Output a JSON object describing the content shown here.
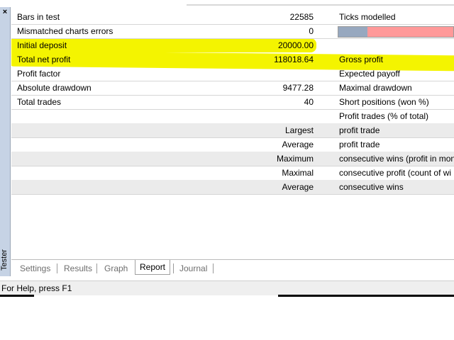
{
  "window": {
    "side_label": "Tester",
    "close_glyph": "×"
  },
  "report": {
    "rows": [
      {
        "label": "Bars in test",
        "value": "22585",
        "right": "Ticks modelled"
      },
      {
        "label": "Mismatched charts errors",
        "value": "0",
        "right": ""
      },
      {
        "label": "Initial deposit",
        "value": "20000.00",
        "right": ""
      },
      {
        "label": "Total net profit",
        "value": "118018.64",
        "right": "Gross profit"
      },
      {
        "label": "Profit factor",
        "value": "",
        "right": "Expected payoff"
      },
      {
        "label": "Absolute drawdown",
        "value": "9477.28",
        "right": "Maximal drawdown"
      },
      {
        "label": "Total trades",
        "value": "40",
        "right": "Short positions (won %)"
      },
      {
        "label": "",
        "value": "",
        "right": "Profit trades (% of total)"
      },
      {
        "label": "",
        "value": "Largest",
        "right": "profit trade"
      },
      {
        "label": "",
        "value": "Average",
        "right": "profit trade"
      },
      {
        "label": "",
        "value": "Maximum",
        "right": "consecutive wins (profit in mon"
      },
      {
        "label": "",
        "value": "Maximal",
        "right": "consecutive profit (count of wi"
      },
      {
        "label": "",
        "value": "Average",
        "right": "consecutive wins"
      }
    ],
    "ticks_quality_fraction": 0.25,
    "colors": {
      "highlight": "#f4f400",
      "bar_fill": "#97a8bf",
      "bar_bg": "#ff9999"
    }
  },
  "tabs": [
    {
      "label": "Settings",
      "active": false
    },
    {
      "label": "Results",
      "active": false
    },
    {
      "label": "Graph",
      "active": false
    },
    {
      "label": "Report",
      "active": true
    },
    {
      "label": "Journal",
      "active": false
    }
  ],
  "status": {
    "text": "For Help, press F1"
  }
}
